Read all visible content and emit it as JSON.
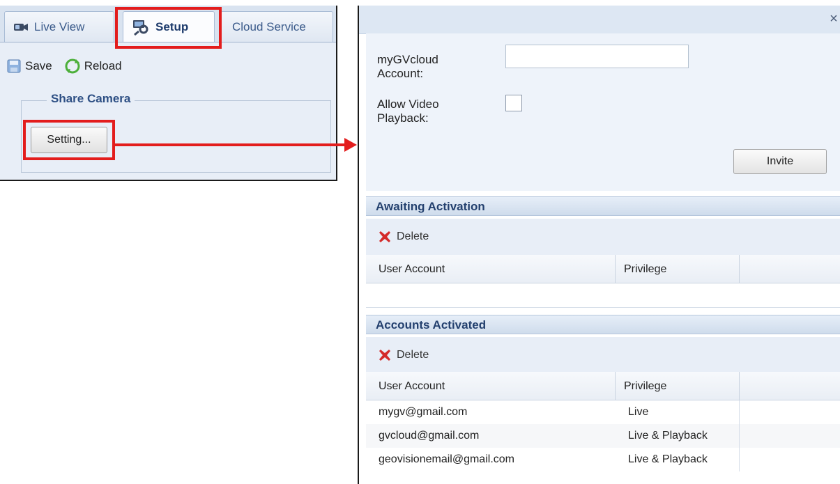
{
  "left_panel": {
    "tabs": [
      {
        "label": "Live View",
        "icon": "camera-icon"
      },
      {
        "label": "Setup",
        "icon": "setup-icon"
      },
      {
        "label": "Cloud Service"
      }
    ],
    "toolbar": {
      "save_label": "Save",
      "reload_label": "Reload"
    },
    "share_camera": {
      "legend": "Share Camera",
      "setting_button": "Setting..."
    }
  },
  "dialog": {
    "close": "×",
    "form": {
      "account_label": "myGVcloud Account:",
      "account_value": "",
      "playback_label": "Allow Video Playback:",
      "playback_checked": false,
      "invite_button": "Invite"
    },
    "awaiting": {
      "title": "Awaiting Activation",
      "delete_label": "Delete",
      "columns": [
        "User Account",
        "Privilege"
      ],
      "rows": []
    },
    "activated": {
      "title": "Accounts Activated",
      "delete_label": "Delete",
      "columns": [
        "User Account",
        "Privilege"
      ],
      "rows": [
        {
          "account": "mygv@gmail.com",
          "privilege": "Live"
        },
        {
          "account": "gvcloud@gmail.com",
          "privilege": "Live & Playback"
        },
        {
          "account": "geovisionemail@gmail.com",
          "privilege": "Live & Playback"
        }
      ]
    }
  },
  "colors": {
    "highlight": "#e31d1d",
    "section_header_text": "#23406e"
  }
}
